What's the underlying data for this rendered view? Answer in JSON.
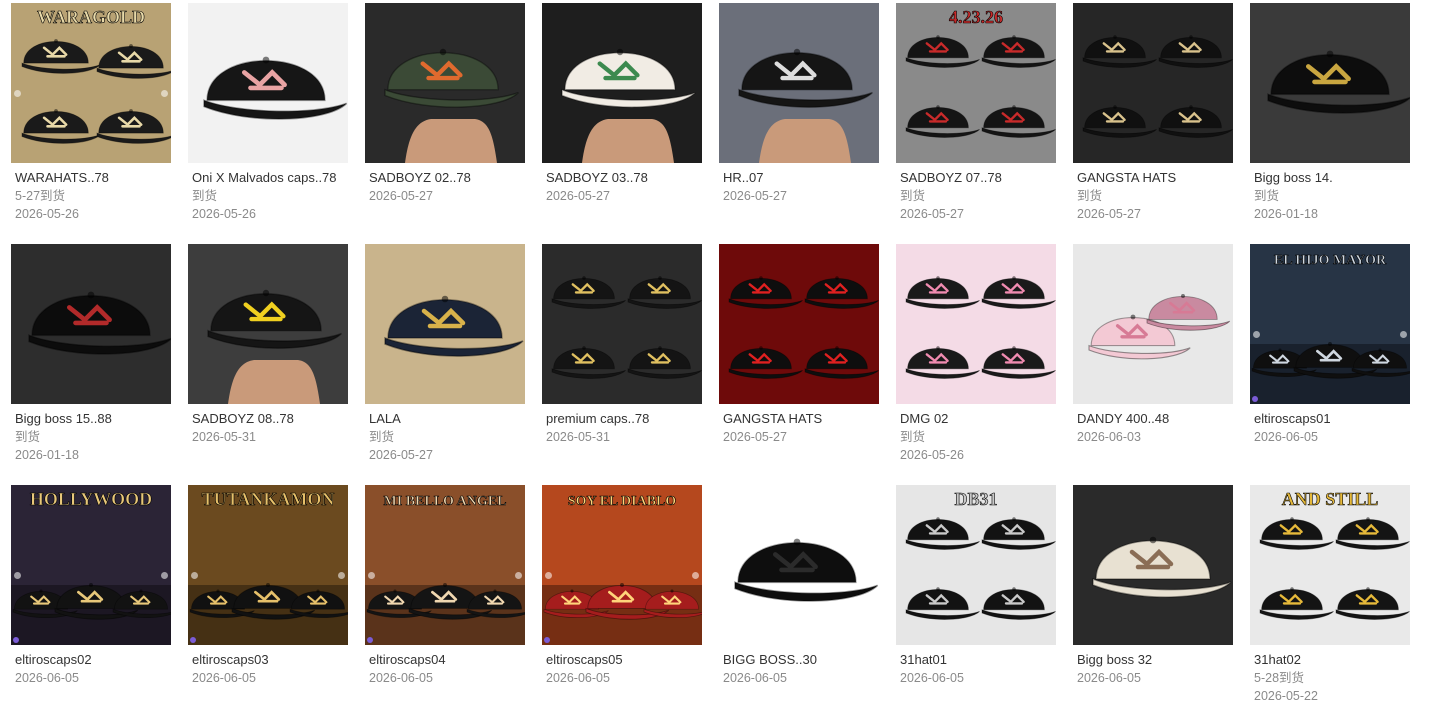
{
  "products": [
    {
      "title": "WARAHATS..78",
      "line2": "5-27到货",
      "line3": "2026-05-26",
      "bg": "#b8a274",
      "cap": "#1a1a1a",
      "accent": "#e8d9a8",
      "theme": "gold-4-caps",
      "overlay": "WARAGOLD"
    },
    {
      "title": "Oni X Malvados caps..78",
      "line2": "到货",
      "line3": "2026-05-26",
      "bg": "#f2f2f2",
      "cap": "#161616",
      "accent": "#e9a3a3",
      "theme": "single-cap-flames",
      "overlay": ""
    },
    {
      "title": "SADBOYZ 02..78",
      "line2": "2026-05-27",
      "line3": "",
      "bg": "#2a2a2a",
      "cap": "#3b4a36",
      "accent": "#e06a2e",
      "theme": "hand-cap",
      "overlay": ""
    },
    {
      "title": "SADBOYZ 03..78",
      "line2": "2026-05-27",
      "line3": "",
      "bg": "#1e1e1e",
      "cap": "#f1ece4",
      "accent": "#3c8a4f",
      "theme": "hand-cap-trucker",
      "overlay": ""
    },
    {
      "title": "HR..07",
      "line2": "2026-05-27",
      "line3": "",
      "bg": "#6b6f7a",
      "cap": "#151515",
      "accent": "#dddddd",
      "theme": "hand-cap-store",
      "overlay": ""
    },
    {
      "title": "SADBOYZ 07..78",
      "line2": "到货",
      "line3": "2026-05-27",
      "bg": "#8a8a8a",
      "cap": "#141414",
      "accent": "#c92a2a",
      "theme": "multi-caps",
      "overlay": "4.23.26"
    },
    {
      "title": "GANGSTA HATS",
      "line2": "到货",
      "line3": "2026-05-27",
      "bg": "#262626",
      "cap": "#101010",
      "accent": "#d9c28c",
      "theme": "multi-caps-dark",
      "overlay": ""
    },
    {
      "title": "Bigg boss 14.",
      "line2": "到货",
      "line3": "2026-01-18",
      "bg": "#3a3a3a",
      "cap": "#0d0d0d",
      "accent": "#c9a640",
      "theme": "ny-cap",
      "overlay": ""
    },
    {
      "title": "Bigg boss 15..88",
      "line2": "到货",
      "line3": "2026-01-18",
      "bg": "#2d2d2d",
      "cap": "#0c0c0c",
      "accent": "#b22a2a",
      "theme": "ny-cap",
      "overlay": ""
    },
    {
      "title": "SADBOYZ 08..78",
      "line2": "2026-05-31",
      "line3": "",
      "bg": "#3d3d3d",
      "cap": "#151515",
      "accent": "#f0d020",
      "theme": "hand-cap",
      "overlay": ""
    },
    {
      "title": "LALA",
      "line2": "到货",
      "line3": "2026-05-27",
      "bg": "#c9b48c",
      "cap": "#1b2436",
      "accent": "#d8b24a",
      "theme": "single-cap-side",
      "overlay": ""
    },
    {
      "title": "premium caps..78",
      "line2": "2026-05-31",
      "line3": "",
      "bg": "#2b2b2b",
      "cap": "#141414",
      "accent": "#e0c060",
      "theme": "multi-caps-dark",
      "overlay": ""
    },
    {
      "title": "GANGSTA HATS",
      "line2": "2026-05-27",
      "line3": "",
      "bg": "#6e0a0a",
      "cap": "#0e0e0e",
      "accent": "#e02020",
      "theme": "multi-caps-red",
      "overlay": ""
    },
    {
      "title": "DMG 02",
      "line2": "到货",
      "line3": "2026-05-26",
      "bg": "#f4dbe6",
      "cap": "#1a1a1a",
      "accent": "#f08bb0",
      "theme": "multi-caps-pink",
      "overlay": ""
    },
    {
      "title": "DANDY 400..48",
      "line2": "2026-06-03",
      "line3": "",
      "bg": "#e8e8e8",
      "cap": "#f3c9d4",
      "accent": "#d77a95",
      "theme": "pink-caps",
      "overlay": ""
    },
    {
      "title": "eltiroscaps01",
      "line2": "2026-06-05",
      "line3": "",
      "bg": "#273445",
      "cap": "#0f0f0f",
      "accent": "#cfd7e0",
      "theme": "scene-caps",
      "overlay": "EL HIJO MAYOR"
    },
    {
      "title": "eltiroscaps02",
      "line2": "2026-06-05",
      "line3": "",
      "bg": "#2b2436",
      "cap": "#121212",
      "accent": "#e8c87a",
      "theme": "scene-caps",
      "overlay": "HOLLYWOOD"
    },
    {
      "title": "eltiroscaps03",
      "line2": "2026-06-05",
      "line3": "",
      "bg": "#6b4a1f",
      "cap": "#111111",
      "accent": "#e6c06a",
      "theme": "scene-caps",
      "overlay": "TUTANKAMON"
    },
    {
      "title": "eltiroscaps04",
      "line2": "2026-06-05",
      "line3": "",
      "bg": "#8a4f2a",
      "cap": "#141414",
      "accent": "#f0d7b0",
      "theme": "scene-caps",
      "overlay": "MI BELLO ANGEL"
    },
    {
      "title": "eltiroscaps05",
      "line2": "2026-06-05",
      "line3": "",
      "bg": "#b5481e",
      "cap": "#a51d1d",
      "accent": "#ffd47a",
      "theme": "scene-caps",
      "overlay": "SOY EL DIABLO"
    },
    {
      "title": "BIGG BOSS..30",
      "line2": "2026-06-05",
      "line3": "",
      "bg": "#ffffff",
      "cap": "#0e0e0e",
      "accent": "#2b2b2b",
      "theme": "single-cap-front",
      "overlay": ""
    },
    {
      "title": "31hat01",
      "line2": "2026-06-05",
      "line3": "",
      "bg": "#e6e6e6",
      "cap": "#121212",
      "accent": "#c9c9c9",
      "theme": "multi-caps",
      "overlay": "DB31"
    },
    {
      "title": "Bigg boss 32",
      "line2": "2026-06-05",
      "line3": "",
      "bg": "#2a2a2a",
      "cap": "#e8e1d2",
      "accent": "#8a6d55",
      "theme": "single-cap-side",
      "overlay": ""
    },
    {
      "title": "31hat02",
      "line2": "5-28到货",
      "line3": "2026-05-22",
      "bg": "#e9e9e9",
      "cap": "#141414",
      "accent": "#e6b93a",
      "theme": "multi-caps",
      "overlay": "AND STILL"
    }
  ]
}
